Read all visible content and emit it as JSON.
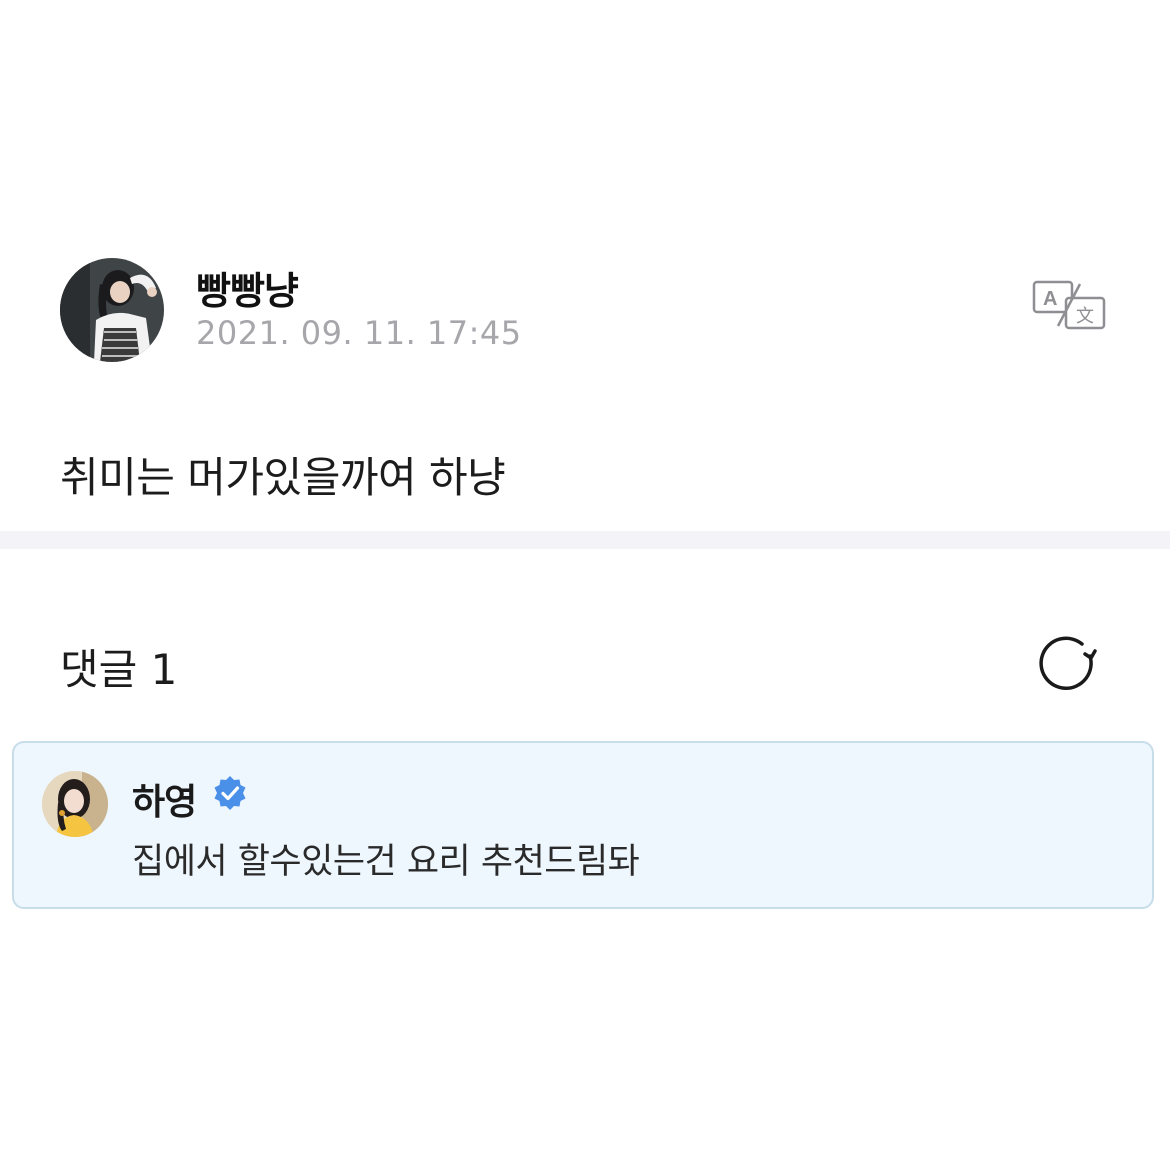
{
  "post": {
    "author": "빵빵냥",
    "date": "2021. 09. 11. 17:45",
    "body": "취미는 머가있을까여 하냥",
    "translate_icon": "translate-icon"
  },
  "comments": {
    "header": "댓글 1",
    "refresh_icon": "refresh-icon",
    "items": [
      {
        "author": "하영",
        "verified": true,
        "text": "집에서 할수있는건 요리 추천드림돠"
      }
    ]
  },
  "colors": {
    "divider": "#f4f4f8",
    "comment_bg": "#eef7fd",
    "comment_border": "#c7dde9",
    "verified": "#4a8fe8",
    "date": "#a6a6ab"
  }
}
